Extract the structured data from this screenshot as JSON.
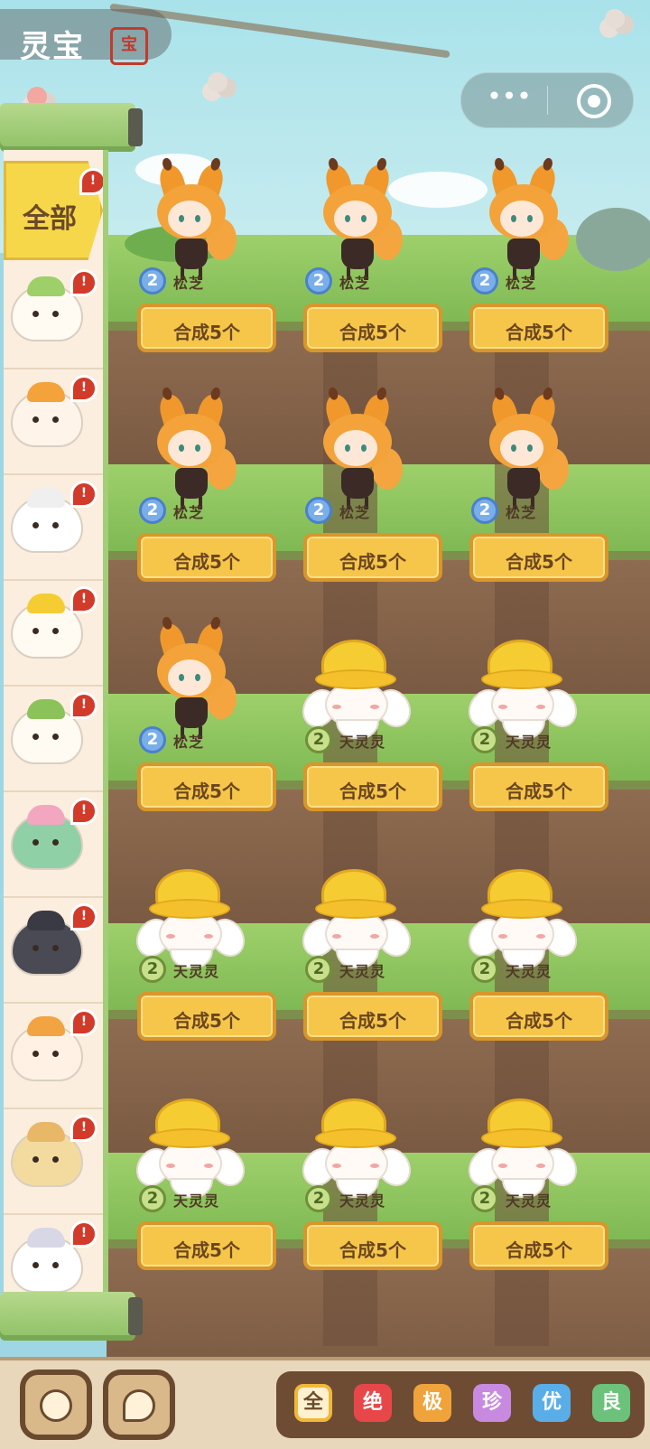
{
  "header": {
    "title": "灵宝",
    "seal_text": "宝"
  },
  "capsule": {
    "more_icon": "more-dots-icon",
    "close_icon": "target-circle-icon"
  },
  "sidebar": {
    "all_tab": "全部",
    "items": [
      {
        "pet": "leaf-hat-pet",
        "color": "#fffaf2",
        "hat": "#9ed06a"
      },
      {
        "pet": "calico-pet",
        "color": "#fff4ea",
        "hat": "#f3a33a"
      },
      {
        "pet": "sheep-pet",
        "color": "#ffffff",
        "hat": "#efefef"
      },
      {
        "pet": "gold-hat-pet",
        "color": "#fffaf2",
        "hat": "#f6cc33"
      },
      {
        "pet": "sprout-pet",
        "color": "#fffaf2",
        "hat": "#8cc25a"
      },
      {
        "pet": "melon-pet",
        "color": "#8fd0a6",
        "hat": "#f2a6c0"
      },
      {
        "pet": "black-cat-pet",
        "color": "#4a4a55",
        "hat": "#3a3a44"
      },
      {
        "pet": "orange-cat-pet",
        "color": "#fff2e4",
        "hat": "#f2a342"
      },
      {
        "pet": "lion-pet",
        "color": "#f3dba0",
        "hat": "#e8b768"
      },
      {
        "pet": "white-cat-pet",
        "color": "#ffffff",
        "hat": "#d7d7e6"
      }
    ],
    "alert_mark": "!"
  },
  "grid": {
    "cells": [
      {
        "type": "squirrel",
        "level": "2",
        "name": "松芝",
        "badge": "blue",
        "button": "合成5个"
      },
      {
        "type": "squirrel",
        "level": "2",
        "name": "松芝",
        "badge": "blue",
        "button": "合成5个"
      },
      {
        "type": "squirrel",
        "level": "2",
        "name": "松芝",
        "badge": "blue",
        "button": "合成5个"
      },
      {
        "type": "squirrel",
        "level": "2",
        "name": "松芝",
        "badge": "blue",
        "button": "合成5个"
      },
      {
        "type": "squirrel",
        "level": "2",
        "name": "松芝",
        "badge": "blue",
        "button": "合成5个"
      },
      {
        "type": "squirrel",
        "level": "2",
        "name": "松芝",
        "badge": "blue",
        "button": "合成5个"
      },
      {
        "type": "squirrel",
        "level": "2",
        "name": "松芝",
        "badge": "blue",
        "button": "合成5个"
      },
      {
        "type": "sprite",
        "level": "2",
        "name": "天灵灵",
        "badge": "green",
        "button": "合成5个"
      },
      {
        "type": "sprite",
        "level": "2",
        "name": "天灵灵",
        "badge": "green",
        "button": "合成5个"
      },
      {
        "type": "sprite",
        "level": "2",
        "name": "天灵灵",
        "badge": "green",
        "button": "合成5个"
      },
      {
        "type": "sprite",
        "level": "2",
        "name": "天灵灵",
        "badge": "green",
        "button": "合成5个"
      },
      {
        "type": "sprite",
        "level": "2",
        "name": "天灵灵",
        "badge": "green",
        "button": "合成5个"
      },
      {
        "type": "sprite",
        "level": "2",
        "name": "天灵灵",
        "badge": "green",
        "button": "合成5个"
      },
      {
        "type": "sprite",
        "level": "2",
        "name": "天灵灵",
        "badge": "green",
        "button": "合成5个"
      },
      {
        "type": "sprite",
        "level": "2",
        "name": "天灵灵",
        "badge": "green",
        "button": "合成5个"
      }
    ]
  },
  "bottom": {
    "left_buttons": [
      "back-arrow-icon",
      "chat-bubble-icon"
    ],
    "filters": [
      {
        "label": "全",
        "color": "#fdf1cf",
        "selected": true
      },
      {
        "label": "绝",
        "color": "#e8474a",
        "selected": false
      },
      {
        "label": "极",
        "color": "#f0a33a",
        "selected": false
      },
      {
        "label": "珍",
        "color": "#c78ae0",
        "selected": false
      },
      {
        "label": "优",
        "color": "#5aaee8",
        "selected": false
      },
      {
        "label": "良",
        "color": "#6cc27a",
        "selected": false
      }
    ]
  }
}
